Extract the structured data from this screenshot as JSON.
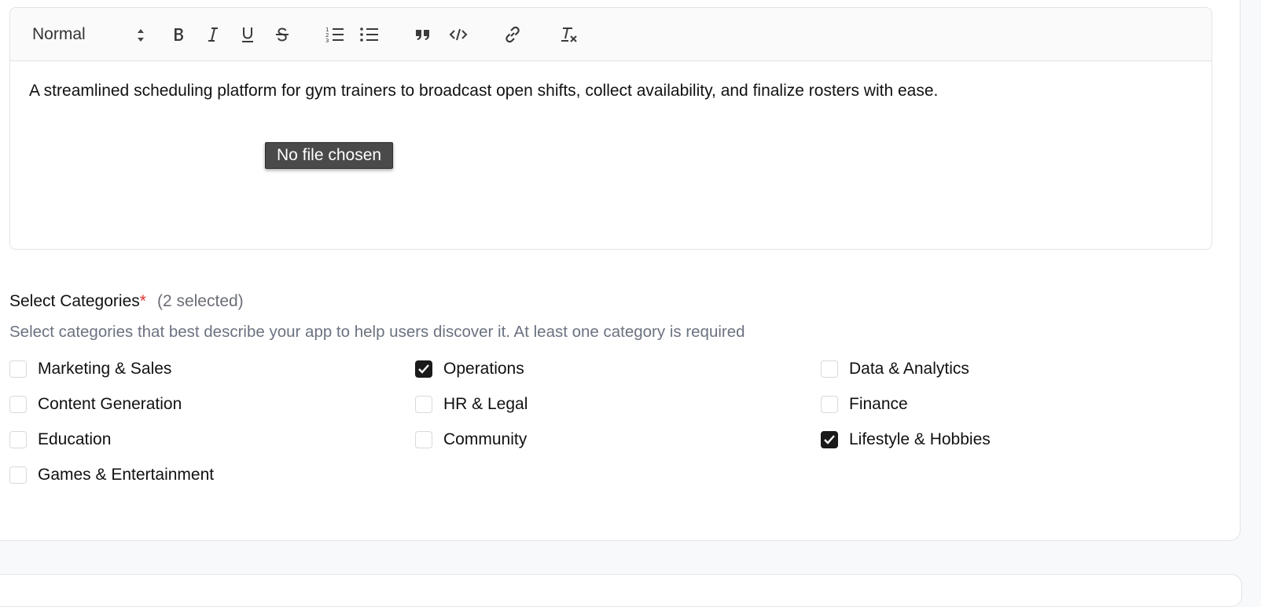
{
  "editor": {
    "format_value": "Normal",
    "content": "A streamlined scheduling platform for gym trainers to broadcast open shifts, collect availability, and finalize rosters with ease.",
    "tooltip": "No file chosen"
  },
  "categories_section": {
    "title": "Select Categories",
    "required_mark": "*",
    "selected_count": "(2 selected)",
    "description": "Select categories that best describe your app to help users discover it. At least one category is required",
    "items": [
      {
        "label": "Marketing & Sales",
        "checked": false
      },
      {
        "label": "Operations",
        "checked": true
      },
      {
        "label": "Data & Analytics",
        "checked": false
      },
      {
        "label": "Content Generation",
        "checked": false
      },
      {
        "label": "HR & Legal",
        "checked": false
      },
      {
        "label": "Finance",
        "checked": false
      },
      {
        "label": "Education",
        "checked": false
      },
      {
        "label": "Community",
        "checked": false
      },
      {
        "label": "Lifestyle & Hobbies",
        "checked": true
      },
      {
        "label": "Games & Entertainment",
        "checked": false
      }
    ]
  },
  "colors": {
    "checkbox_checked": "#1a1a1a",
    "required": "#e03131",
    "muted_text": "#6b7280"
  }
}
